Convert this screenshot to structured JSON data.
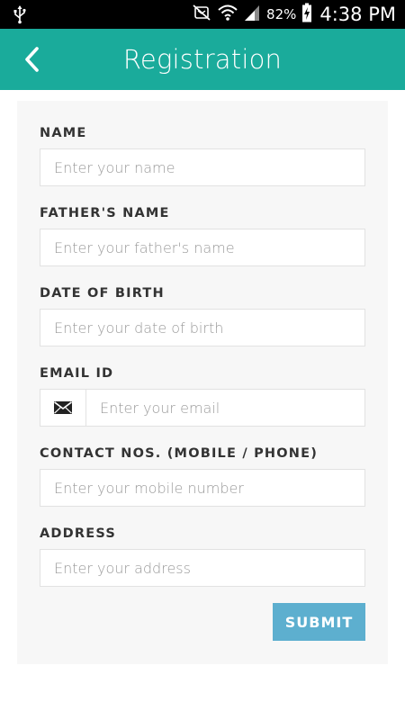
{
  "status_bar": {
    "battery_percent": "82%",
    "time": "4:38 PM",
    "icons": [
      "usb-icon",
      "mute-icon",
      "wifi-icon",
      "signal-icon",
      "battery-charging-icon"
    ]
  },
  "app_bar": {
    "title": "Registration",
    "back_icon": "chevron-left-icon",
    "background_color": "#1aab9b"
  },
  "form": {
    "fields": {
      "name": {
        "label": "NAME",
        "placeholder": "Enter your name",
        "value": ""
      },
      "fathers_name": {
        "label": "FATHER'S NAME",
        "placeholder": "Enter your father's name",
        "value": ""
      },
      "date_of_birth": {
        "label": "DATE OF BIRTH",
        "placeholder": "Enter your date of birth",
        "value": ""
      },
      "email": {
        "label": "EMAIL ID",
        "placeholder": "Enter your email",
        "value": "",
        "icon": "envelope-icon"
      },
      "contact": {
        "label": "CONTACT NOS. (MOBILE / PHONE)",
        "placeholder": "Enter your mobile number",
        "value": ""
      },
      "address": {
        "label": "ADDRESS",
        "placeholder": "Enter your address",
        "value": ""
      }
    },
    "submit_label": "SUBMIT",
    "submit_color": "#5dafcf"
  }
}
